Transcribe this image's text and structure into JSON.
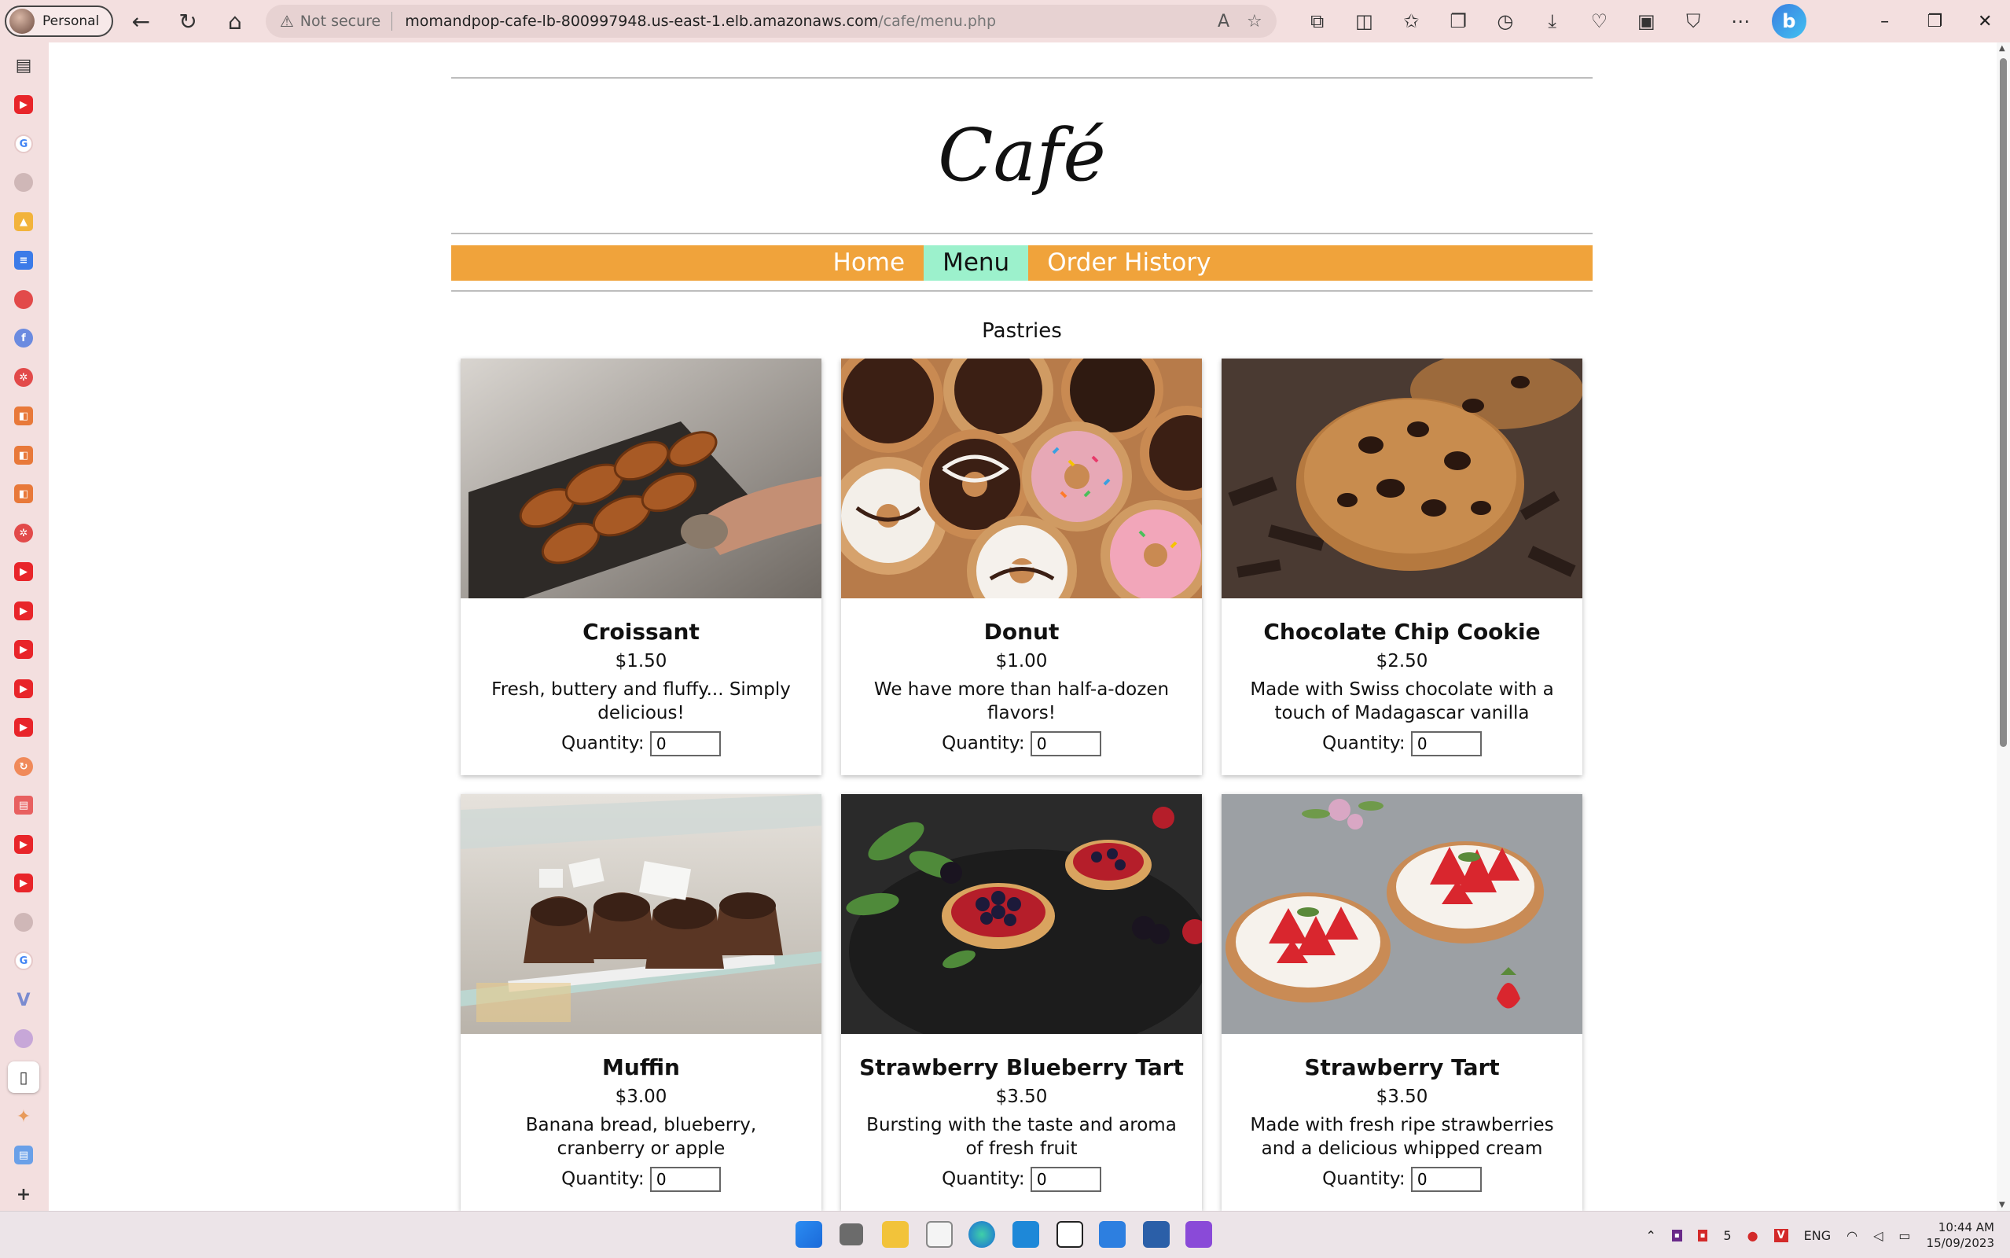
{
  "browser": {
    "profile_label": "Personal",
    "security_label": "Not secure",
    "url_host": "momandpop-cafe-lb-800997948.us-east-1.elb.amazonaws.com",
    "url_path": "/cafe/menu.php"
  },
  "site": {
    "title": "Café",
    "nav": [
      "Home",
      "Menu",
      "Order History"
    ],
    "active_nav": "Menu",
    "section_title": "Pastries",
    "quantity_label": "Quantity:"
  },
  "products": [
    {
      "name": "Croissant",
      "price": "$1.50",
      "description": "Fresh, buttery and fluffy... Simply delicious!",
      "quantity": "0"
    },
    {
      "name": "Donut",
      "price": "$1.00",
      "description": "We have more than half-a-dozen flavors!",
      "quantity": "0"
    },
    {
      "name": "Chocolate Chip Cookie",
      "price": "$2.50",
      "description": "Made with Swiss chocolate with a touch of Madagascar vanilla",
      "quantity": "0"
    },
    {
      "name": "Muffin",
      "price": "$3.00",
      "description": "Banana bread, blueberry, cranberry or apple",
      "quantity": "0"
    },
    {
      "name": "Strawberry Blueberry Tart",
      "price": "$3.50",
      "description": "Bursting with the taste and aroma of fresh fruit",
      "quantity": "0"
    },
    {
      "name": "Strawberry Tart",
      "price": "$3.50",
      "description": "Made with fresh ripe strawberries and a delicious whipped cream",
      "quantity": "0"
    }
  ],
  "taskbar": {
    "language": "ENG",
    "time": "10:44 AM",
    "date": "15/09/2023",
    "badge_count": "5"
  },
  "colors": {
    "nav_bar": "#f0a33b",
    "nav_active": "#9cf1cc",
    "browser_chrome": "#f3dfdf"
  }
}
